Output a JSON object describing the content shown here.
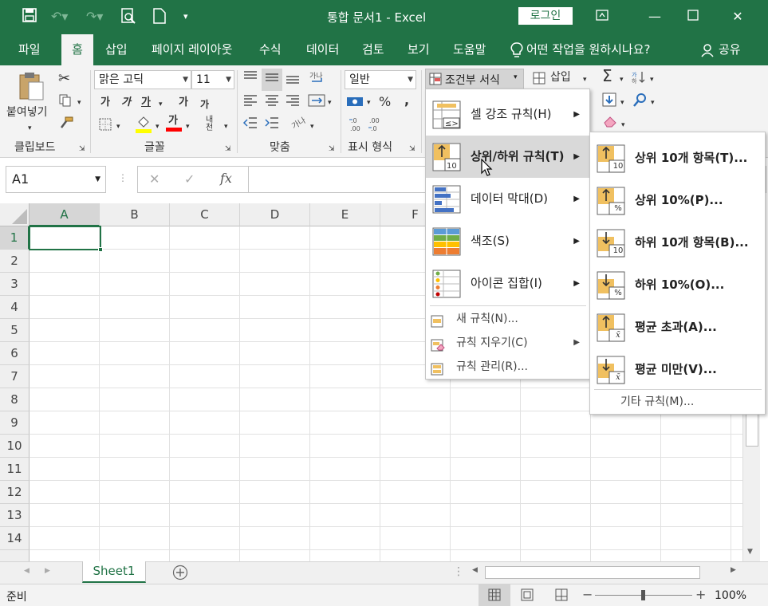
{
  "window": {
    "title": "통합 문서1  -  Excel",
    "login_label": "로그인"
  },
  "tabs": [
    {
      "label": "파일"
    },
    {
      "label": "홈"
    },
    {
      "label": "삽입"
    },
    {
      "label": "페이지 레이아웃"
    },
    {
      "label": "수식"
    },
    {
      "label": "데이터"
    },
    {
      "label": "검토"
    },
    {
      "label": "보기"
    },
    {
      "label": "도움말"
    }
  ],
  "tellme": "어떤 작업을 원하시나요?",
  "share_label": "공유",
  "ribbon": {
    "paste_label": "붙여넣기",
    "clipboard_label": "클립보드",
    "font_name": "맑은 고딕",
    "font_size": "11",
    "font_group_label": "글꼴",
    "align_group_label": "맞춤",
    "number_format": "일반",
    "number_group_label": "표시 형식",
    "cond_format_label": "조건부 서식",
    "insert_label": "삽입",
    "bold": "가",
    "italic": "가",
    "underline": "가",
    "grow": "가",
    "shrink": "가",
    "fontcolor_char": "가",
    "phonetic": "내천",
    "percent": "%",
    "comma": ",",
    "dec_inc": "←.0\n.00",
    "dec_dec": ".00\n→.0"
  },
  "formula": {
    "namebox": "A1",
    "cancel": "✕",
    "enter": "✓",
    "fx": "fx"
  },
  "columns": [
    "A",
    "B",
    "C",
    "D",
    "E",
    "F"
  ],
  "rows": [
    "1",
    "2",
    "3",
    "4",
    "5",
    "6",
    "7",
    "8",
    "9",
    "10",
    "11",
    "12",
    "13",
    "14"
  ],
  "main_menu": {
    "items": [
      {
        "label": "셀 강조 규칙(H)"
      },
      {
        "label": "상위/하위 규칙(T)"
      },
      {
        "label": "데이터 막대(D)"
      },
      {
        "label": "색조(S)"
      },
      {
        "label": "아이콘 집합(I)"
      }
    ],
    "small_items": [
      {
        "label": "새 규칙(N)..."
      },
      {
        "label": "규칙 지우기(C)"
      },
      {
        "label": "규칙 관리(R)..."
      }
    ]
  },
  "sub_menu": {
    "items": [
      {
        "label": "상위 10개 항목(T)...",
        "badge": "10"
      },
      {
        "label": "상위 10%(P)...",
        "badge": "%"
      },
      {
        "label": "하위 10개 항목(B)...",
        "badge": "10"
      },
      {
        "label": "하위 10%(O)...",
        "badge": "%"
      },
      {
        "label": "평균 초과(A)...",
        "badge": "x̄"
      },
      {
        "label": "평균 미만(V)...",
        "badge": "x̄"
      }
    ],
    "more_label": "기타 규칙(M)..."
  },
  "sheet_tab": "Sheet1",
  "status": {
    "ready": "준비",
    "zoom": "100%"
  },
  "colors": {
    "accent": "#217346",
    "highlight_yellow": "#ffff00",
    "fontcolor_red": "#ff0000",
    "icon_gold": "#f0c060"
  }
}
